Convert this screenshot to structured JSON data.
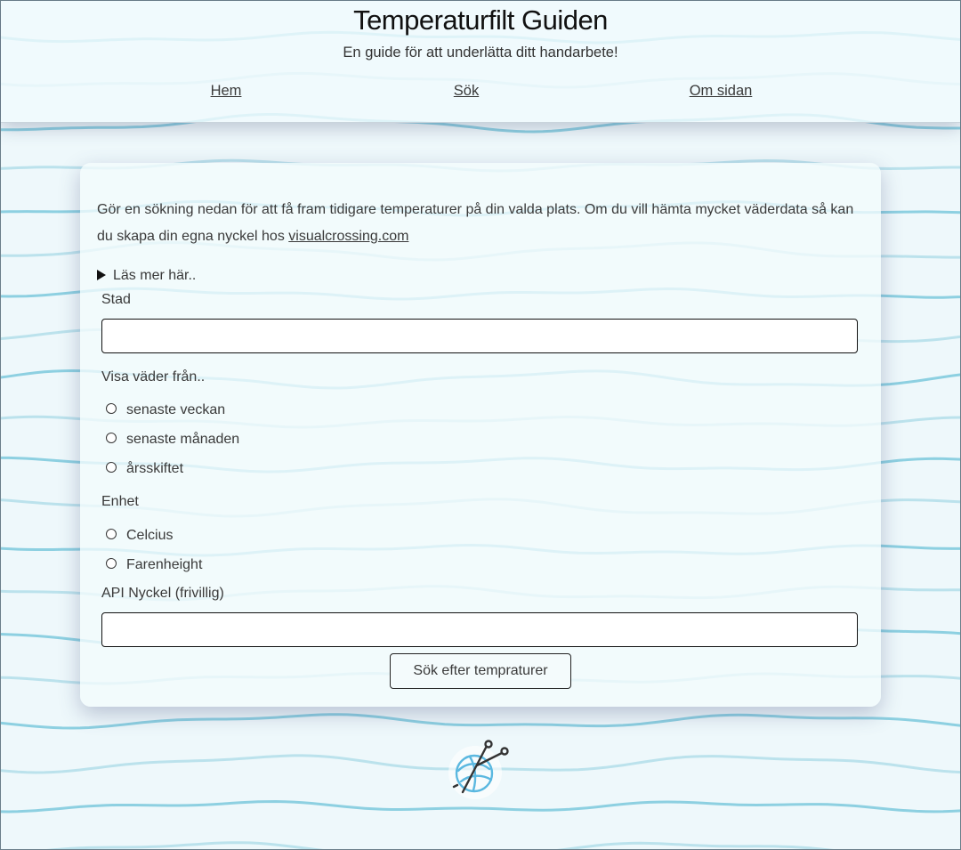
{
  "header": {
    "title": "Temperaturfilt Guiden",
    "subtitle": "En guide för att underlätta ditt handarbete!"
  },
  "nav": {
    "items": [
      {
        "label": "Hem"
      },
      {
        "label": "Sök"
      },
      {
        "label": "Om sidan"
      }
    ]
  },
  "form": {
    "intro_text": "Gör en sökning nedan för att få fram tidigare temperaturer på din valda plats. Om du vill hämta mycket väderdata så kan du skapa din egna nyckel hos",
    "intro_link": "visualcrossing.com",
    "details_summary": "Läs mer här..",
    "city_label": "Stad",
    "city_value": "",
    "period_label": "Visa väder från..",
    "period_options": [
      "senaste veckan",
      "senaste månaden",
      "årsskiftet"
    ],
    "unit_label": "Enhet",
    "unit_options": [
      "Celcius",
      "Farenheight"
    ],
    "api_label": "API Nyckel (frivillig)",
    "api_value": "",
    "submit_label": "Sök efter tempraturer"
  },
  "colors": {
    "background": "#eef8fb",
    "wave_primary": "#6cc3d8",
    "wave_light": "#a9dbe7",
    "logo": "#5bb8e0"
  },
  "footer": {
    "logo_icon": "yarn-ball-needles-icon"
  }
}
